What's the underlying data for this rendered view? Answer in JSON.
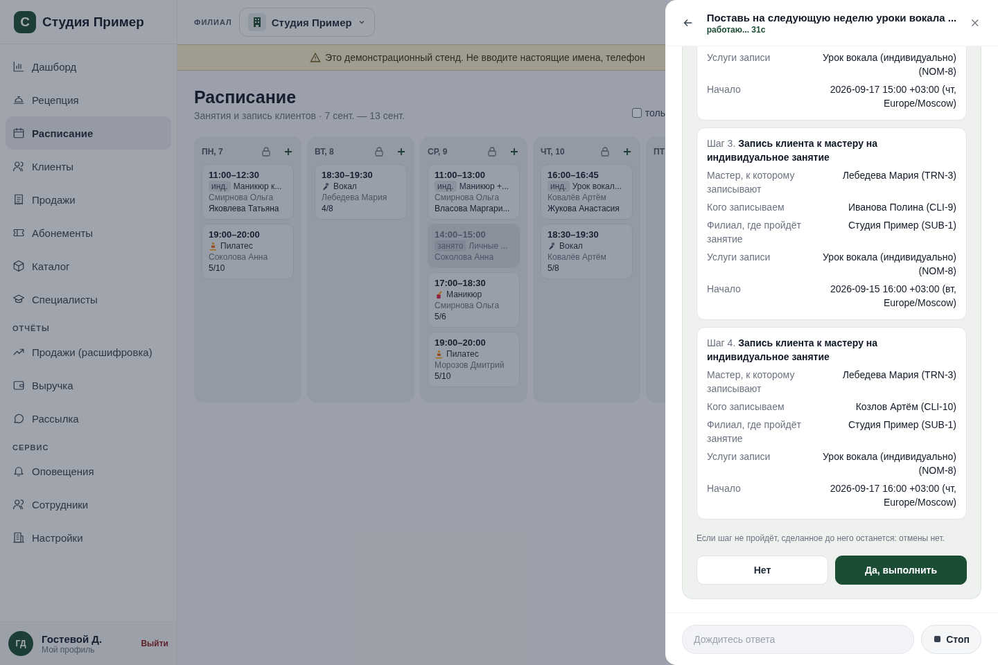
{
  "sidebar": {
    "logo_letter": "С",
    "brand": "Студия Пример",
    "groups": [
      {
        "items": [
          {
            "kind": "chart",
            "label": "Дашборд",
            "selected": false
          },
          {
            "kind": "reception",
            "label": "Рецепция",
            "selected": false
          },
          {
            "kind": "calendar",
            "label": "Расписание",
            "selected": true
          },
          {
            "kind": "users",
            "label": "Клиенты",
            "selected": false
          },
          {
            "kind": "receipt",
            "label": "Продажи",
            "selected": false
          },
          {
            "kind": "ticket",
            "label": "Абонементы",
            "selected": false
          },
          {
            "kind": "box",
            "label": "Каталог",
            "selected": false
          },
          {
            "kind": "cap",
            "label": "Специалисты",
            "selected": false
          }
        ]
      },
      {
        "title": "ОТЧЁТЫ",
        "items": [
          {
            "kind": "trend",
            "label": "Продажи (расшифровка)",
            "selected": false
          },
          {
            "kind": "wallet",
            "label": "Выручка",
            "selected": false
          },
          {
            "kind": "chat",
            "label": "Рассылка",
            "selected": false
          }
        ]
      },
      {
        "title": "СЕРВИС",
        "items": [
          {
            "kind": "bell",
            "label": "Оповещения",
            "selected": false
          },
          {
            "kind": "team",
            "label": "Сотрудники",
            "selected": false
          },
          {
            "kind": "building",
            "label": "Настройки",
            "selected": false
          }
        ]
      }
    ],
    "user": {
      "initials": "ГД",
      "name": "Гостевой Д.",
      "subtitle": "Мой профиль",
      "logout": "Выйти"
    }
  },
  "topbar": {
    "branch_label": "ФИЛИАЛ",
    "branch": "Студия Пример"
  },
  "banner": "Это демонстрационный стенд. Не вводите настоящие имена, телефон",
  "page": {
    "title": "Расписание",
    "subtitle": "Занятия и запись клиентов · 7 сент. — 13 сент.",
    "filter": {
      "label": "толь",
      "checked": false
    }
  },
  "days": [
    {
      "label": "ПН, 7",
      "events": [
        {
          "time": "11:00–12:30",
          "tag": "инд.",
          "title": "Маникюр к...",
          "trainer": "Смирнова Ольга",
          "line": "Яковлева Татьяна",
          "busy": false
        },
        {
          "time": "19:00–20:00",
          "kind": "yoga",
          "title": "Пилатес",
          "trainer": "Соколова Анна",
          "line": "5/10",
          "busy": false
        }
      ]
    },
    {
      "label": "ВТ, 8",
      "events": [
        {
          "time": "18:30–19:30",
          "kind": "mic",
          "title": "Вокал",
          "trainer": "Лебедева Мария",
          "line": "4/8",
          "busy": false
        }
      ]
    },
    {
      "label": "СР, 9",
      "events": [
        {
          "time": "11:00–13:00",
          "tag": "инд.",
          "title": "Маникюр +...",
          "trainer": "Смирнова Ольга",
          "line": "Власова Маргари...",
          "busy": false
        },
        {
          "time": "14:00–15:00",
          "tag": "занято",
          "title": "Личные ...",
          "trainer": "Соколова Анна",
          "busy": true
        },
        {
          "time": "17:00–18:30",
          "kind": "nail",
          "title": "Маникюр",
          "trainer": "Смирнова Ольга",
          "line": "5/6",
          "busy": false
        },
        {
          "time": "19:00–20:00",
          "kind": "yoga",
          "title": "Пилатес",
          "trainer": "Морозов Дмитрий",
          "line": "5/10",
          "busy": false
        }
      ]
    },
    {
      "label": "ЧТ, 10",
      "events": [
        {
          "time": "16:00–16:45",
          "tag": "инд.",
          "title": "Урок вокал...",
          "trainer": "Ковалёв Артём",
          "line": "Жукова Анастасия",
          "busy": false
        },
        {
          "time": "18:30–19:30",
          "kind": "mic",
          "title": "Вокал",
          "trainer": "Ковалёв Артём",
          "line": "5/8",
          "busy": false
        }
      ]
    },
    {
      "label": "ПТ"
    }
  ],
  "drawer": {
    "title": "Поставь на следующую неделю уроки вокала ...",
    "status": "работаю... 31с",
    "steps": [
      {
        "rows": [
          {
            "label": "Услуги записи",
            "value": "Урок вокала (индивидуально) (NOM-8)"
          },
          {
            "label": "Начало",
            "value": "2026-09-17 15:00 +03:00 (чт, Europe/Moscow)"
          }
        ]
      },
      {
        "number": "Шаг 3.",
        "title": "Запись клиента к мастеру на индивидуальное занятие",
        "rows": [
          {
            "label": "Мастер, к которому записывают",
            "value": "Лебедева Мария (TRN-3)"
          },
          {
            "label": "Кого записываем",
            "value": "Иванова Полина (CLI-9)"
          },
          {
            "label": "Филиал, где пройдёт занятие",
            "value": "Студия Пример (SUB-1)"
          },
          {
            "label": "Услуги записи",
            "value": "Урок вокала (индивидуально) (NOM-8)"
          },
          {
            "label": "Начало",
            "value": "2026-09-15 16:00 +03:00 (вт, Europe/Moscow)"
          }
        ]
      },
      {
        "number": "Шаг 4.",
        "title": "Запись клиента к мастеру на индивидуальное занятие",
        "rows": [
          {
            "label": "Мастер, к которому записывают",
            "value": "Лебедева Мария (TRN-3)"
          },
          {
            "label": "Кого записываем",
            "value": "Козлов Артём (CLI-10)"
          },
          {
            "label": "Филиал, где пройдёт занятие",
            "value": "Студия Пример (SUB-1)"
          },
          {
            "label": "Услуги записи",
            "value": "Урок вокала (индивидуально) (NOM-8)"
          },
          {
            "label": "Начало",
            "value": "2026-09-17 16:00 +03:00 (чт, Europe/Moscow)"
          }
        ]
      }
    ],
    "note": "Если шаг не пройдёт, сделанное до него останется: отмены нет.",
    "cancel": "Нет",
    "confirm": "Да, выполнить",
    "input": {
      "placeholder": "Дождитесь ответа"
    },
    "stop": "Стоп"
  }
}
